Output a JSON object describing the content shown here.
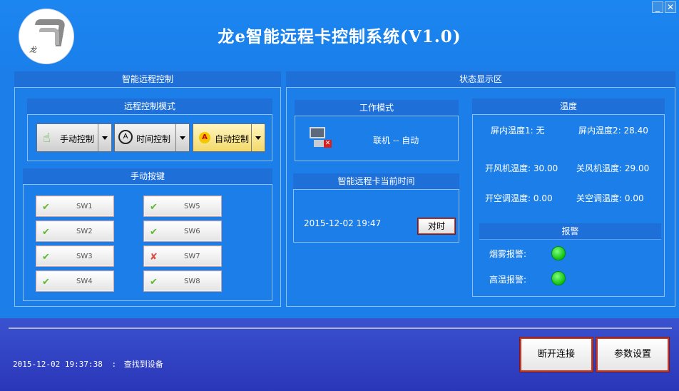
{
  "window": {
    "title": "龙e智能远程卡控制系统(V1.0)",
    "brand_text": "龙"
  },
  "left": {
    "header": "智能远程控制",
    "mode_header": "远程控制模式",
    "modes": [
      "手动控制",
      "时间控制",
      "自动控制"
    ],
    "active_mode": "自动控制",
    "keys_header": "手动按键",
    "switches": [
      {
        "label": "SW1",
        "state": "on"
      },
      {
        "label": "SW2",
        "state": "on"
      },
      {
        "label": "SW3",
        "state": "on"
      },
      {
        "label": "SW4",
        "state": "on"
      },
      {
        "label": "SW5",
        "state": "on"
      },
      {
        "label": "SW6",
        "state": "on"
      },
      {
        "label": "SW7",
        "state": "off"
      },
      {
        "label": "SW8",
        "state": "on"
      }
    ]
  },
  "right": {
    "header": "状态显示区",
    "work_mode": {
      "header": "工作模式",
      "status": "联机 -- 自动"
    },
    "card_time": {
      "header": "智能远程卡当前时间",
      "value": "2015-12-02 19:47",
      "sync_button": "对时"
    },
    "temperature": {
      "header": "温度",
      "in1_label": "屏内温度1:",
      "in1_value": "无",
      "in2_label": "屏内温度2:",
      "in2_value": "28.40",
      "fan_on_label": "开风机温度:",
      "fan_on_value": "30.00",
      "fan_off_label": "关风机温度:",
      "fan_off_value": "29.00",
      "ac_on_label": "开空调温度:",
      "ac_on_value": "0.00",
      "ac_off_label": "关空调温度:",
      "ac_off_value": "0.00"
    },
    "alarm": {
      "header": "报警",
      "smoke_label": "烟雾报警:",
      "heat_label": "高温报警:",
      "indicator_color": "#22dd22"
    }
  },
  "footer": {
    "timestamp": "2015-12-02 19:37:38",
    "separator": ":",
    "message": "查找到设备",
    "disconnect_button": "断开连接",
    "settings_button": "参数设置"
  },
  "colors": {
    "background": "#1c7ee8",
    "panel_bar": "#1f6fd8",
    "footer": "#2f3fc4"
  }
}
